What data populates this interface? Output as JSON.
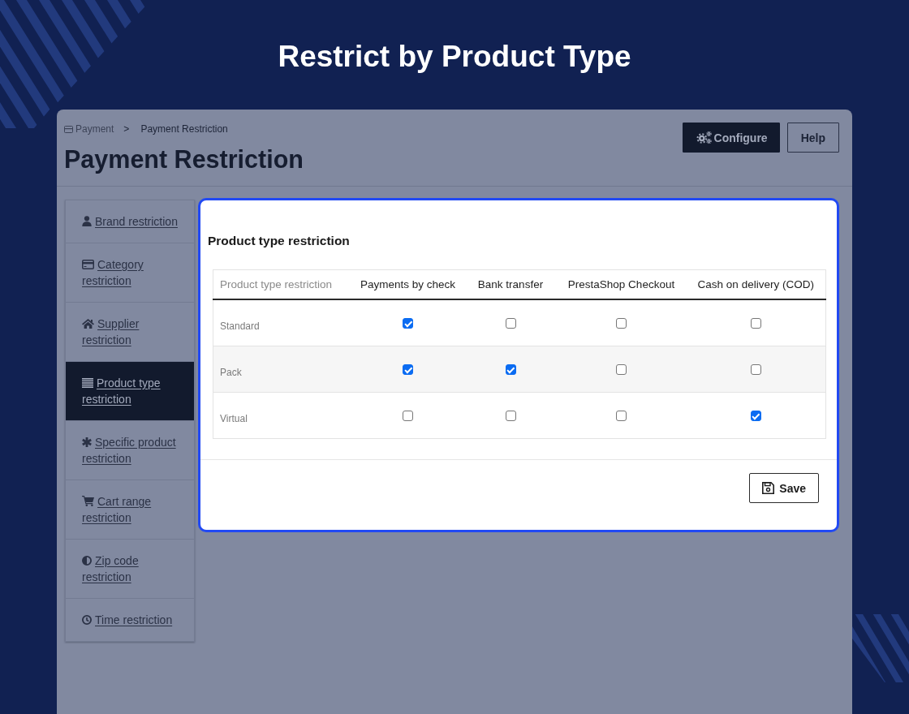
{
  "banner": {
    "title": "Restrict by Product Type"
  },
  "breadcrumb": {
    "items": [
      {
        "label": "Payment"
      },
      {
        "label": "Payment Restriction"
      }
    ],
    "separator": ">"
  },
  "page_title": "Payment Restriction",
  "header_buttons": [
    {
      "label": "Configure",
      "kind": "primary"
    },
    {
      "label": "Help",
      "kind": "outline"
    }
  ],
  "sidebar": {
    "items": [
      {
        "label": "Brand restriction",
        "selected": false
      },
      {
        "label": "Category restriction",
        "selected": false
      },
      {
        "label": "Supplier restriction",
        "selected": false
      },
      {
        "label": "Product type restriction",
        "selected": true
      },
      {
        "label": "Specific product restriction",
        "selected": false
      },
      {
        "label": "Cart range restriction",
        "selected": false
      },
      {
        "label": "Zip code restriction",
        "selected": false
      },
      {
        "label": "Time restriction",
        "selected": false
      }
    ]
  },
  "panel": {
    "title": "Product type restriction",
    "table": {
      "columns": [
        "Product type restriction",
        "Payments by check",
        "Bank transfer",
        "PrestaShop Checkout",
        "Cash on delivery (COD)"
      ],
      "rows": [
        {
          "label": "Standard",
          "checks": [
            true,
            false,
            false,
            false
          ]
        },
        {
          "label": "Pack",
          "checks": [
            true,
            true,
            false,
            false
          ]
        },
        {
          "label": "Virtual",
          "checks": [
            false,
            false,
            false,
            true
          ]
        }
      ]
    },
    "save_button": "Save"
  }
}
